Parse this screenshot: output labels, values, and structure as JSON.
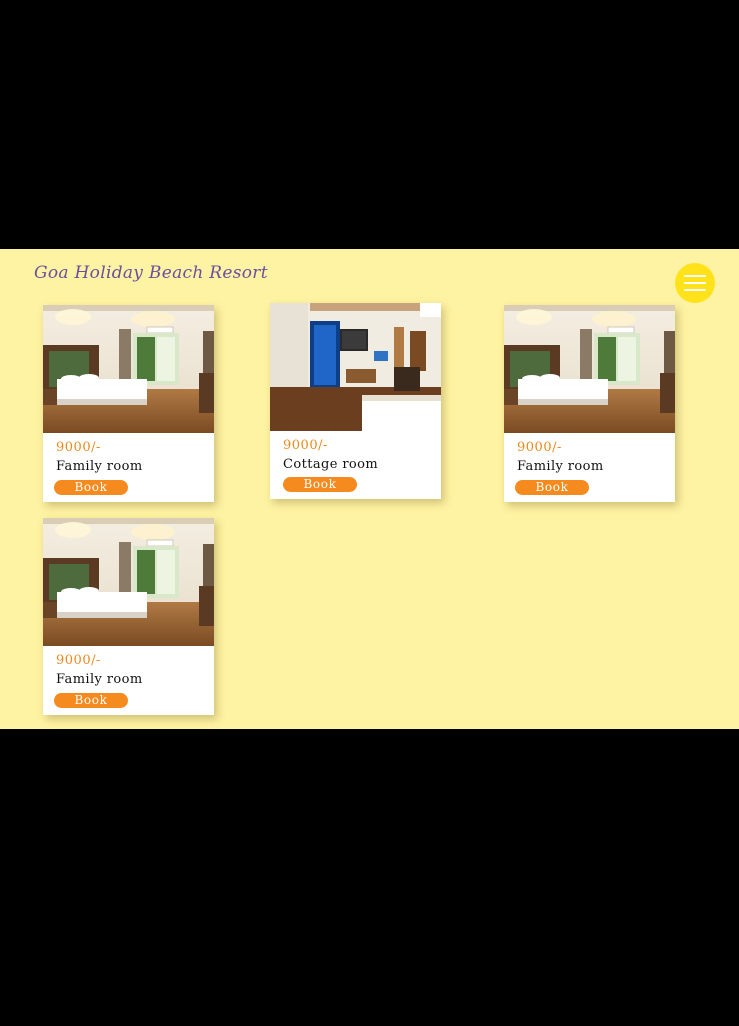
{
  "header": {
    "brand": "Goa Holiday Beach Resort",
    "menu_icon": "hamburger-icon"
  },
  "colors": {
    "page_background": "#FEF3A2",
    "accent_orange": "#F58A1F",
    "price_text": "#E98A1E",
    "menu_button": "#FFE21A",
    "brand_text": "#6B4EA0"
  },
  "rooms": [
    {
      "price": "9000/-",
      "name": "Family room",
      "button": "Book",
      "photo": "hotel-bedroom-photo"
    },
    {
      "price": "9000/-",
      "name": "Cottage room",
      "button": "Book",
      "photo": "cottage-room-photo"
    },
    {
      "price": "9000/-",
      "name": "Family room",
      "button": "Book",
      "photo": "hotel-bedroom-photo"
    },
    {
      "price": "9000/-",
      "name": "Family room",
      "button": "Book",
      "photo": "hotel-bedroom-photo"
    }
  ]
}
